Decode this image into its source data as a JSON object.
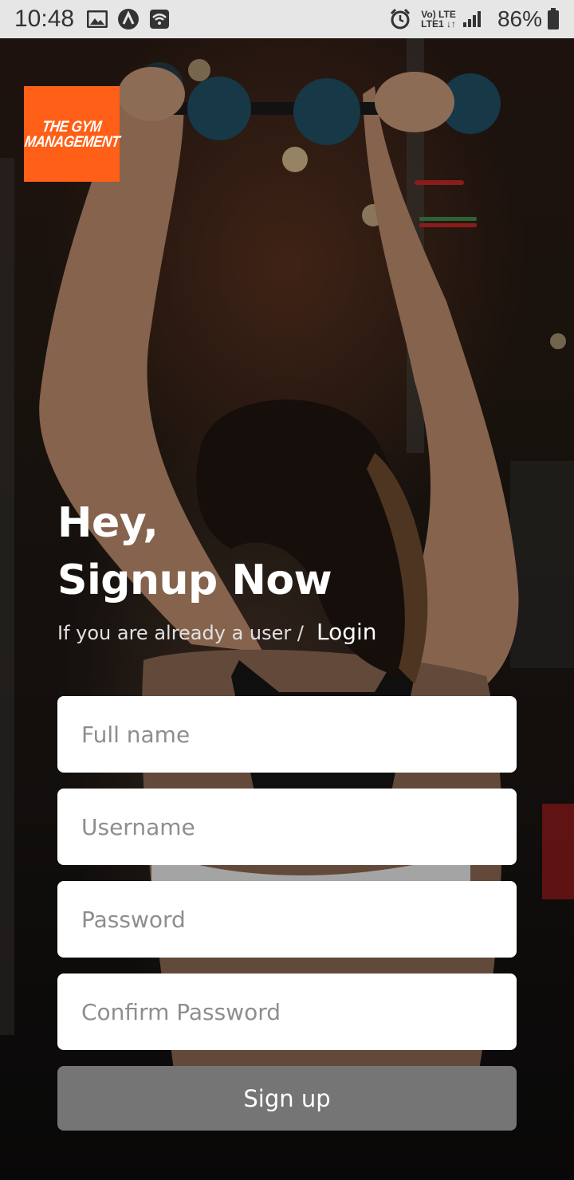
{
  "status_bar": {
    "time": "10:48",
    "battery_percent": "86%",
    "network_top": "Vo) LTE",
    "network_bottom": "LTE1 ↓↑",
    "icons": [
      "image-icon",
      "app-notification-icon",
      "wifi-icon",
      "alarm-icon",
      "signal-icon",
      "battery-icon"
    ]
  },
  "logo": {
    "line1": "THE GYM",
    "line2": "MANAGEMENT",
    "color": "#ff5f16"
  },
  "heading": {
    "line1": "Hey,",
    "line2": "Signup Now"
  },
  "subline": {
    "text": "If you are already a user /",
    "login_label": "Login"
  },
  "form": {
    "full_name": {
      "placeholder": "Full name",
      "value": ""
    },
    "username": {
      "placeholder": "Username",
      "value": ""
    },
    "password": {
      "placeholder": "Password",
      "value": ""
    },
    "confirm_password": {
      "placeholder": "Confirm Password",
      "value": ""
    },
    "submit_label": "Sign up"
  },
  "colors": {
    "button_bg": "#757575",
    "input_bg": "#ffffff",
    "accent": "#ff5f16"
  }
}
